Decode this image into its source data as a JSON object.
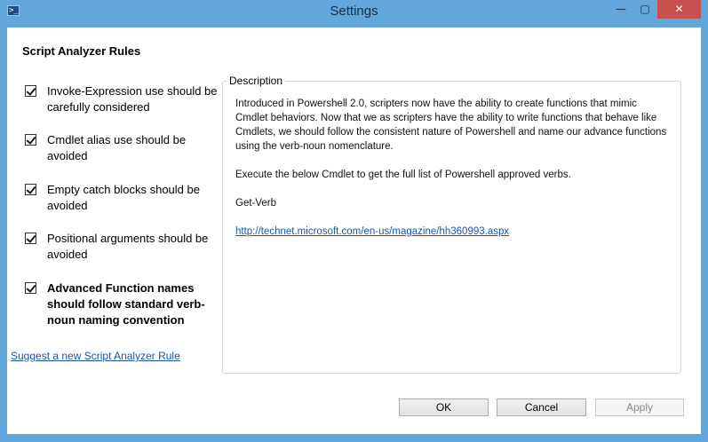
{
  "window": {
    "title": "Settings",
    "icons": {
      "app": "powershell-icon",
      "minimize": "minimize-icon",
      "maximize": "maximize-icon",
      "close": "close-icon"
    },
    "glyphs": {
      "app": ">_",
      "minimize": "—",
      "maximize": "▢",
      "close": "✕"
    },
    "colors": {
      "frame": "#62a7dc",
      "close": "#c7504f",
      "link": "#1a55a8"
    }
  },
  "panel": {
    "section_title": "Script Analyzer Rules"
  },
  "rules": [
    {
      "label": "Invoke-Expression use should be carefully considered",
      "checked": true
    },
    {
      "label": "Cmdlet alias use should be avoided",
      "checked": true
    },
    {
      "label": "Empty catch blocks should be avoided",
      "checked": true
    },
    {
      "label": "Positional arguments should  be avoided",
      "checked": true
    },
    {
      "label": "Advanced Function names should follow standard verb-noun naming convention",
      "checked": true
    }
  ],
  "suggest_link": "Suggest a new Script Analyzer Rule",
  "description": {
    "legend": "Description",
    "para1": "Introduced in Powershell 2.0, scripters now have the ability to create functions that mimic Cmdlet behaviors.   Now that we as scripters have the ability to write functions that behave like Cmdlets, we should follow the consistent nature of Powershell and name our advance functions using the verb-noun nomenclature.",
    "para2": "Execute the below Cmdlet to get the full list of Powershell approved verbs.",
    "para3": "Get-Verb",
    "link": "http://technet.microsoft.com/en-us/magazine/hh360993.aspx"
  },
  "buttons": {
    "ok": "OK",
    "cancel": "Cancel",
    "apply": "Apply"
  }
}
